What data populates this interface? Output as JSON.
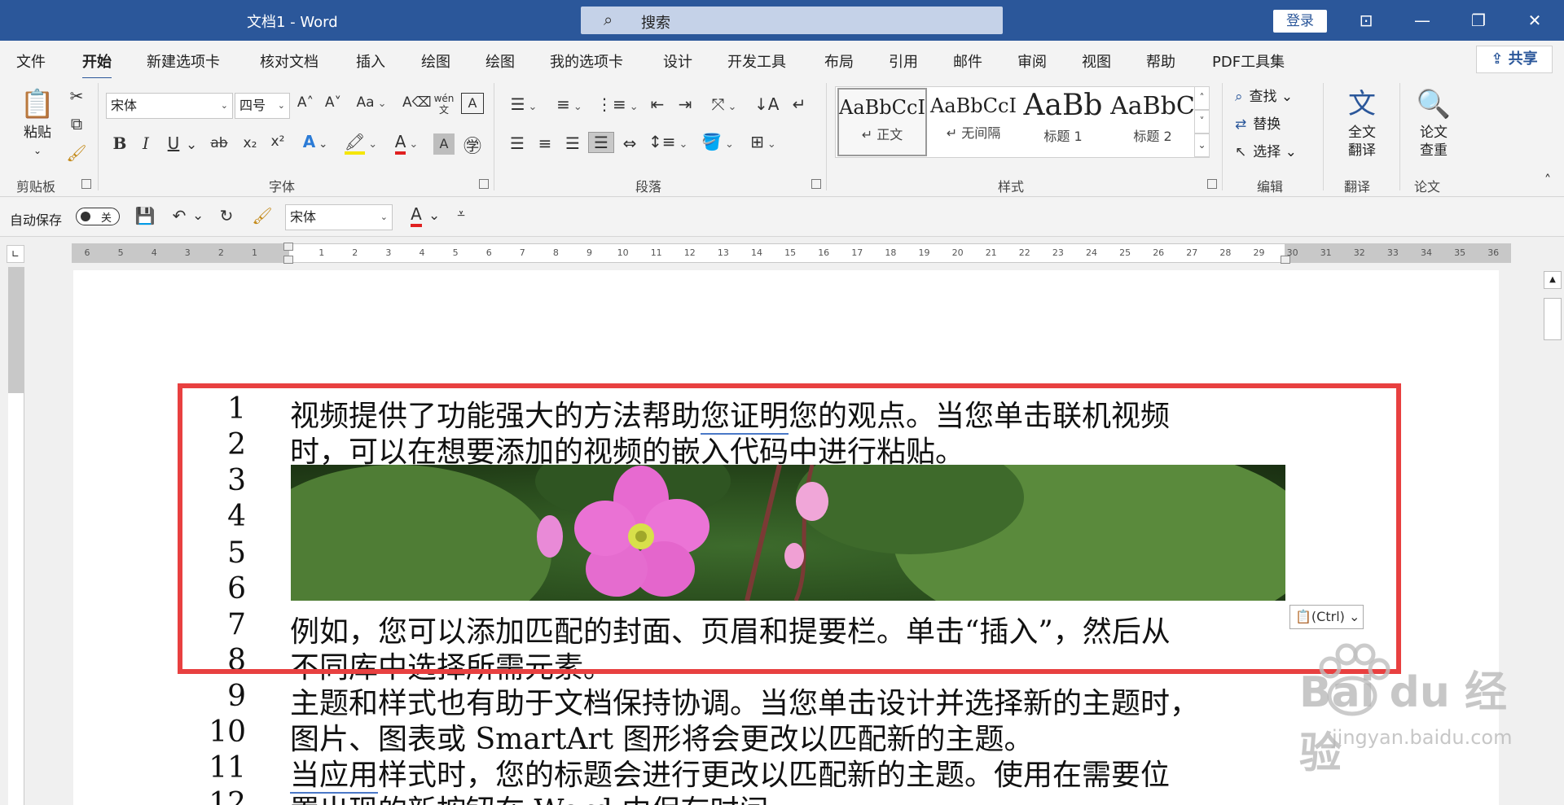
{
  "window": {
    "title": "文档1  -  Word",
    "search_placeholder": "搜索",
    "login": "登录"
  },
  "menu_tabs": [
    "文件",
    "开始",
    "新建选项卡",
    "核对文档",
    "插入",
    "绘图",
    "绘图",
    "我的选项卡",
    "设计",
    "开发工具",
    "布局",
    "引用",
    "邮件",
    "审阅",
    "视图",
    "帮助",
    "PDF工具集"
  ],
  "active_tab": "开始",
  "share": "共享",
  "ribbon": {
    "clipboard": {
      "paste": "粘贴",
      "label": "剪贴板"
    },
    "font": {
      "family": "宋体",
      "size": "四号",
      "label": "字体",
      "case": "Aa",
      "bold": "B",
      "italic": "I",
      "underline": "U",
      "strike": "ab",
      "sub": "x₂",
      "sup": "x²",
      "color_a": "A",
      "wen": "wén"
    },
    "paragraph": {
      "label": "段落"
    },
    "styles": {
      "label": "样式",
      "items": [
        {
          "preview": "AaBbCcI",
          "name": "↵ 正文"
        },
        {
          "preview": "AaBbCcI",
          "name": "↵ 无间隔"
        },
        {
          "preview": "AaBb",
          "name": "标题 1"
        },
        {
          "preview": "AaBbC",
          "name": "标题 2"
        }
      ]
    },
    "editing": {
      "label": "编辑",
      "find": "查找",
      "replace": "替换",
      "select": "选择"
    },
    "translate": {
      "label": "翻译",
      "button": "全文\n翻译",
      "line1": "全文",
      "line2": "翻译"
    },
    "paper": {
      "label": "论文",
      "line1": "论文",
      "line2": "查重"
    }
  },
  "qat": {
    "autosave": "自动保存",
    "toggle": "关",
    "font": "宋体"
  },
  "ruler": {
    "numbers": [
      "6",
      "5",
      "4",
      "3",
      "2",
      "1",
      "1",
      "2",
      "3",
      "4",
      "5",
      "6",
      "7",
      "8",
      "9",
      "10",
      "11",
      "12",
      "13",
      "14",
      "15",
      "16",
      "17",
      "18",
      "19",
      "20",
      "21",
      "22",
      "23",
      "24",
      "25",
      "26",
      "27",
      "28",
      "29",
      "30",
      "31",
      "32",
      "33",
      "34",
      "35",
      "36"
    ]
  },
  "document": {
    "line_numbers": [
      "1",
      "2",
      "3",
      "4",
      "5",
      "6",
      "7",
      "8",
      "9",
      "10",
      "11",
      "12"
    ],
    "lines": {
      "l1a": "视频提供了功能强大的方法帮助",
      "l1b": "您证明",
      "l1c": "您的观点。当您单击联机视频",
      "l2": "时，可以在想要添加的视频的嵌入代码中进行粘贴。",
      "l7": "例如，您可以添加匹配的封面、页眉和提要栏。单击“插入”，然后从",
      "l8": "不同库中选择所需元素。",
      "l9": "主题和样式也有助于文档保持协调。当您单击设计并选择新的主题时，",
      "l10": "图片、图表或 SmartArt 图形将会更改以匹配新的主题。",
      "l11a": "当应用",
      "l11b": "样式时，您的标题会进行更改以匹配新的主题。使用在需要位",
      "l12": "置出现的新按钮在 Word 中保存时间"
    },
    "paste_options": "(Ctrl)"
  },
  "watermark": {
    "brand": "Bai du 经验",
    "url": "jingyan.baidu.com"
  }
}
